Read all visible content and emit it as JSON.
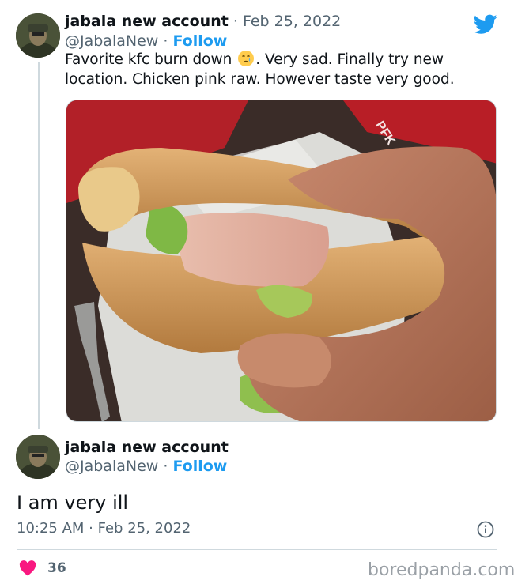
{
  "tweet1": {
    "display_name": "jabala new account",
    "separator": "·",
    "date": "Feb 25, 2022",
    "handle": "@JabalaNew",
    "follow": "Follow",
    "text_before_emoji": "Favorite kfc burn down ",
    "emoji": "crying-face",
    "text_after_emoji": ". Very sad. Finally try new location. Chicken pink raw. However taste very good.",
    "media_box_text": "PFK"
  },
  "tweet2": {
    "display_name": "jabala new account",
    "handle": "@JabalaNew",
    "separator": "·",
    "follow": "Follow",
    "text": "I am very ill",
    "timestamp": "10:25 AM · Feb 25, 2022",
    "likes": "36"
  },
  "watermark": "boredpanda.com",
  "colors": {
    "twitter_blue": "#1d9bf0",
    "heart": "#f91880",
    "muted": "#536471"
  }
}
